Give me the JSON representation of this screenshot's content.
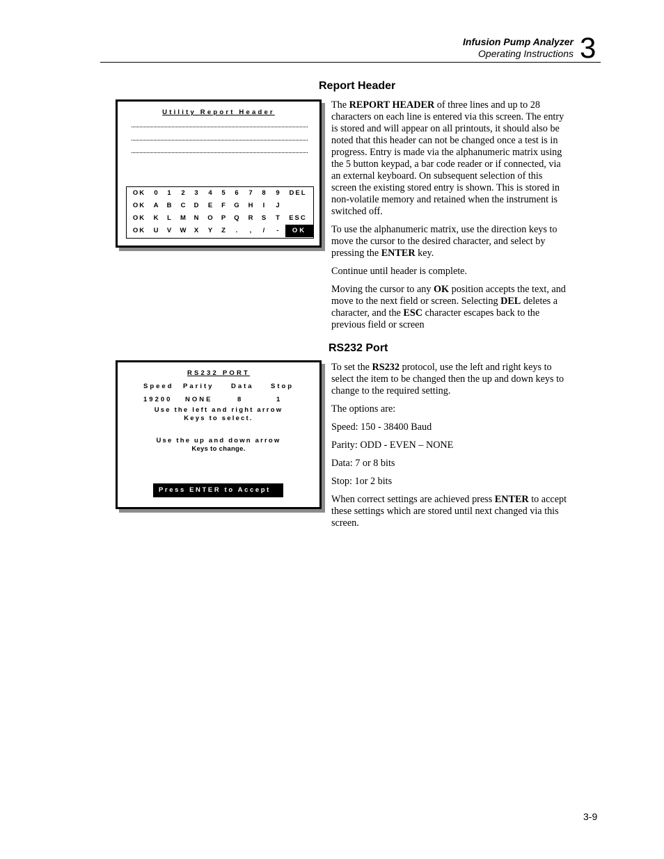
{
  "running_header": {
    "title": "Infusion Pump Analyzer",
    "subtitle": "Operating Instructions",
    "chapter": "3"
  },
  "sections": [
    {
      "heading": "Report Header",
      "paragraphs": [
        [
          {
            "t": "The "
          },
          {
            "b": "REPORT HEADER"
          },
          {
            "t": " of three lines and up to 28 characters on each line is entered via this screen. The entry is stored and will appear on all printouts, it should also be noted that this header can not be changed once a test is in progress. Entry is made via the alphanumeric matrix using the 5 button keypad, a bar code reader or if connected, via an external keyboard. On subsequent selection of this screen the existing stored entry is shown. This is stored in non-volatile memory and retained when the instrument is switched off."
          }
        ],
        [
          {
            "t": "To use the alphanumeric matrix, use the direction keys to move the cursor to the desired character, and select by pressing the "
          },
          {
            "b": "ENTER"
          },
          {
            "t": " key."
          }
        ],
        [
          {
            "t": "Continue until header is complete."
          }
        ],
        [
          {
            "t": "Moving the cursor to any "
          },
          {
            "b": "OK"
          },
          {
            "t": " position accepts the text, and move to the next field or screen. Selecting "
          },
          {
            "b": "DEL"
          },
          {
            "t": " deletes a character, and the "
          },
          {
            "b": "ESC"
          },
          {
            "t": " character escapes back to the previous field or screen"
          }
        ]
      ]
    },
    {
      "heading": "RS232 Port",
      "paragraphs": [
        [
          {
            "t": "To set the "
          },
          {
            "b": "RS232"
          },
          {
            "t": " protocol, use the left and right keys to select the item to be changed then the up and down keys to change to the required setting."
          }
        ],
        [
          {
            "t": "The options are:"
          }
        ],
        [
          {
            "t": "Speed: 150 - 38400 Baud"
          }
        ],
        [
          {
            "t": "Parity: ODD - EVEN – NONE"
          }
        ],
        [
          {
            "t": "Data: 7 or 8 bits"
          }
        ],
        [
          {
            "t": "Stop: 1or 2 bits"
          }
        ],
        [
          {
            "t": "When correct settings are achieved press "
          },
          {
            "b": "ENTER"
          },
          {
            "t": " to accept these settings which are stored until next changed via this screen."
          }
        ]
      ]
    }
  ],
  "screen_report_header": {
    "title": "Utility Report Header",
    "entry_lines": [
      "",
      "",
      ""
    ],
    "matrix": [
      [
        "OK",
        "0",
        "1",
        "2",
        "3",
        "4",
        "5",
        "6",
        "7",
        "8",
        "9",
        "DEL"
      ],
      [
        "OK",
        "A",
        "B",
        "C",
        "D",
        "E",
        "F",
        "G",
        "H",
        "I",
        "J",
        ""
      ],
      [
        "OK",
        "K",
        "L",
        "M",
        "N",
        "O",
        "P",
        "Q",
        "R",
        "S",
        "T",
        "ESC"
      ],
      [
        "OK",
        "U",
        "V",
        "W",
        "X",
        "Y",
        "Z",
        ".",
        ",",
        "/",
        "-",
        "OK"
      ]
    ],
    "selected": "OK"
  },
  "screen_rs232": {
    "title": "RS232 PORT",
    "columns": [
      "Speed",
      "Parity",
      "Data",
      "Stop"
    ],
    "values": [
      "19200",
      "NONE",
      "8",
      "1"
    ],
    "hint1_line1": "Use the left and right arrow",
    "hint1_line2": "Keys to select.",
    "hint2_line1": "Use the up and down arrow",
    "hint2_line2": "Keys to change.",
    "accept_label": "Press ENTER to Accept"
  },
  "page_number": "3-9"
}
